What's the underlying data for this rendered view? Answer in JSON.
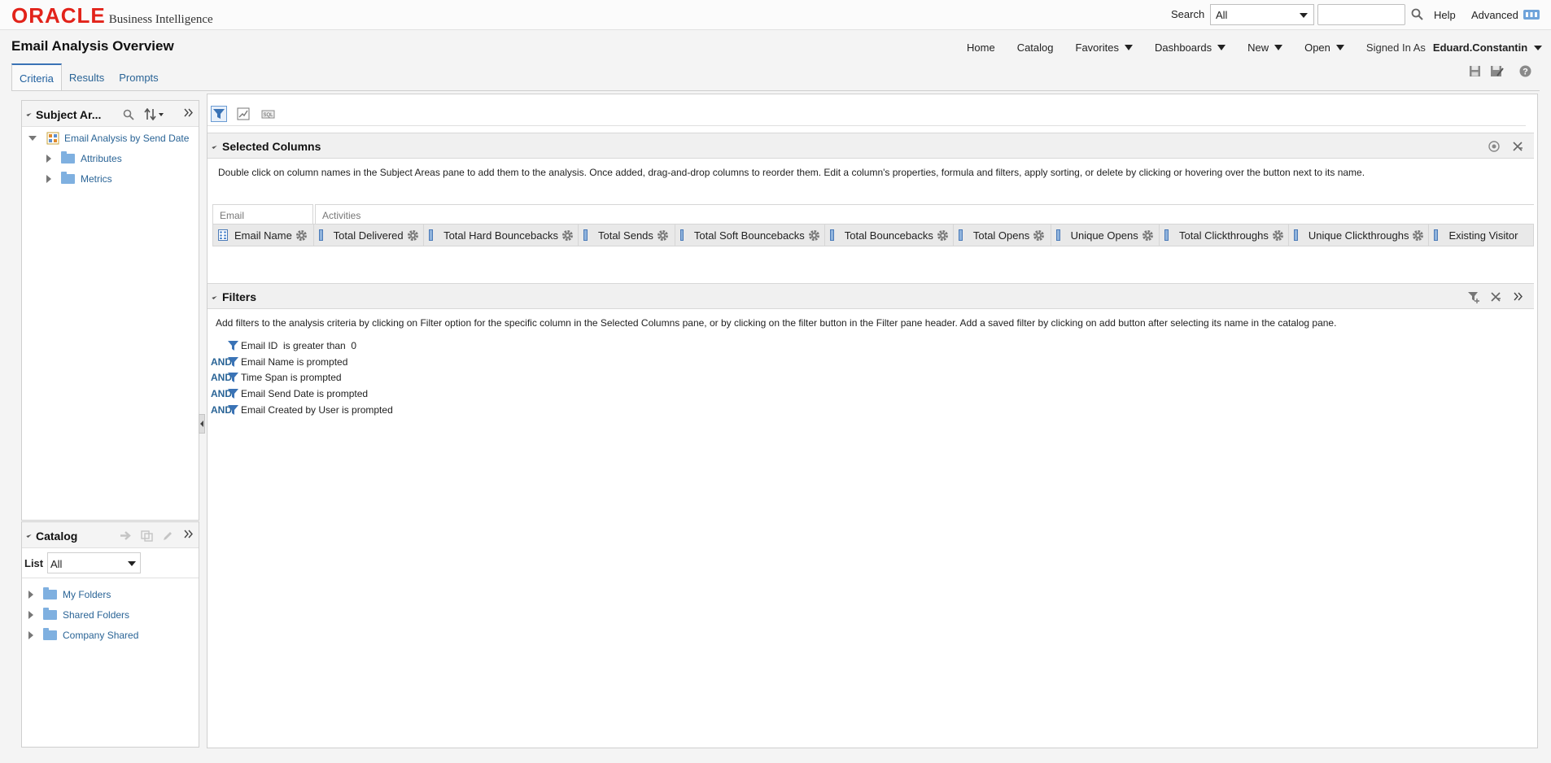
{
  "brand": {
    "oracle_word": "ORACLE",
    "product": "Business Intelligence",
    "brand_color": "#e2231a"
  },
  "global_header": {
    "search_label": "Search",
    "search_scope": "All",
    "search_query": "",
    "help": "Help",
    "advanced": "Advanced"
  },
  "page": {
    "title": "Email Analysis Overview"
  },
  "nav": {
    "home": "Home",
    "catalog": "Catalog",
    "favorites": "Favorites",
    "dashboards": "Dashboards",
    "new": "New",
    "open": "Open",
    "signed_in_label": "Signed In As",
    "user": "Eduard.Constantin"
  },
  "tabs": [
    {
      "label": "Criteria",
      "active": true
    },
    {
      "label": "Results",
      "active": false
    },
    {
      "label": "Prompts",
      "active": false
    }
  ],
  "subject_areas": {
    "title": "Subject Ar...",
    "root": "Email Analysis by Send Date",
    "children": [
      "Attributes",
      "Metrics"
    ]
  },
  "catalog_panel": {
    "title": "Catalog",
    "list_label": "List",
    "list_value": "All",
    "folders": [
      "My Folders",
      "Shared Folders",
      "Company Shared"
    ]
  },
  "selected_columns": {
    "title": "Selected Columns",
    "description": "Double click on column names in the Subject Areas pane to add them to the analysis. Once added, drag-and-drop columns to reorder them. Edit a column's properties, formula and filters, apply sorting, or delete by clicking or hovering over the button next to its name.",
    "groups": [
      "Email",
      "Activities"
    ],
    "columns": [
      "Email Name",
      "Total Delivered",
      "Total Hard Bouncebacks",
      "Total Sends",
      "Total Soft Bouncebacks",
      "Total Bouncebacks",
      "Total Opens",
      "Unique Opens",
      "Total Clickthroughs",
      "Unique Clickthroughs",
      "Existing Visitor"
    ]
  },
  "filters": {
    "title": "Filters",
    "description": "Add filters to the analysis criteria by clicking on Filter option for the specific column in the Selected Columns pane, or by clicking on the filter button in the Filter pane header. Add a saved filter by clicking on add button after selecting its name in the catalog pane.",
    "conjunction": "AND",
    "items": [
      "Email ID  is greater than  0",
      "Email Name is prompted",
      "Time Span is prompted",
      "Email Send Date is prompted",
      "Email Created by User is prompted"
    ]
  },
  "colors": {
    "link": "#2a6496",
    "accent": "#3a73b6",
    "panel_border": "#cfcfcf"
  }
}
